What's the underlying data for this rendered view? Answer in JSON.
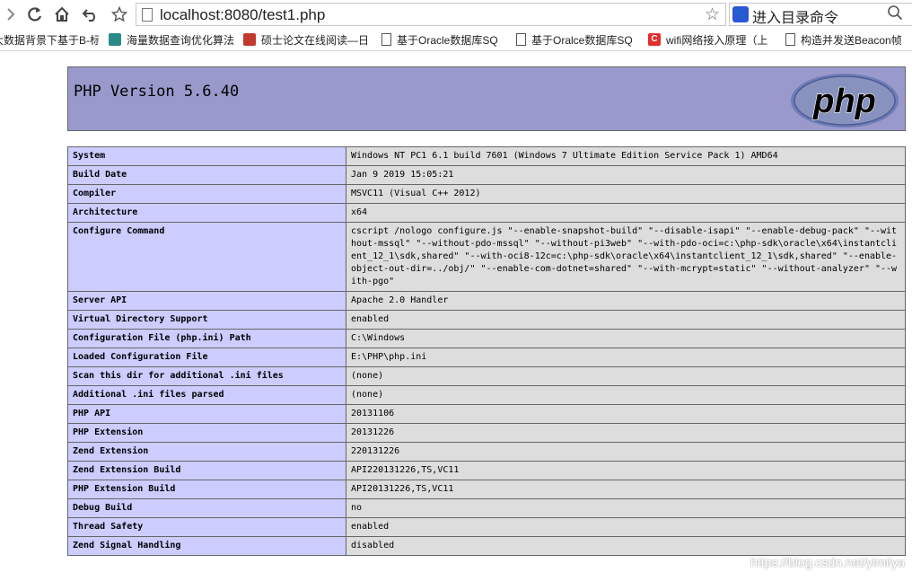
{
  "toolbar": {
    "url": "localhost:8080/test1.php",
    "search_text": "进入目录命令"
  },
  "bookmarks": [
    {
      "label": "大数据背景下基于B-标",
      "icon": "page"
    },
    {
      "label": "海量数据查询优化算法",
      "icon": "segmentfault"
    },
    {
      "label": "硕士论文在线阅读—日",
      "icon": "cnki"
    },
    {
      "label": "基于Oracle数据库SQ",
      "icon": "page"
    },
    {
      "label": "基于Oralce数据库SQ",
      "icon": "page"
    },
    {
      "label": "wifi网络接入原理（上",
      "icon": "csdn"
    },
    {
      "label": "构造并发送Beacon帧",
      "icon": "page"
    }
  ],
  "php": {
    "title": "PHP Version 5.6.40",
    "logo_text": "php",
    "rows": [
      {
        "key": "System",
        "value": "Windows NT PC1 6.1 build 7601 (Windows 7 Ultimate Edition Service Pack 1) AMD64"
      },
      {
        "key": "Build Date",
        "value": "Jan 9 2019 15:05:21"
      },
      {
        "key": "Compiler",
        "value": "MSVC11 (Visual C++ 2012)"
      },
      {
        "key": "Architecture",
        "value": "x64"
      },
      {
        "key": "Configure Command",
        "value": "cscript /nologo configure.js \"--enable-snapshot-build\" \"--disable-isapi\" \"--enable-debug-pack\" \"--without-mssql\" \"--without-pdo-mssql\" \"--without-pi3web\" \"--with-pdo-oci=c:\\php-sdk\\oracle\\x64\\instantclient_12_1\\sdk,shared\" \"--with-oci8-12c=c:\\php-sdk\\oracle\\x64\\instantclient_12_1\\sdk,shared\" \"--enable-object-out-dir=../obj/\" \"--enable-com-dotnet=shared\" \"--with-mcrypt=static\" \"--without-analyzer\" \"--with-pgo\""
      },
      {
        "key": "Server API",
        "value": "Apache 2.0 Handler"
      },
      {
        "key": "Virtual Directory Support",
        "value": "enabled"
      },
      {
        "key": "Configuration File (php.ini) Path",
        "value": "C:\\Windows"
      },
      {
        "key": "Loaded Configuration File",
        "value": "E:\\PHP\\php.ini"
      },
      {
        "key": "Scan this dir for additional .ini files",
        "value": "(none)"
      },
      {
        "key": "Additional .ini files parsed",
        "value": "(none)"
      },
      {
        "key": "PHP API",
        "value": "20131106"
      },
      {
        "key": "PHP Extension",
        "value": "20131226"
      },
      {
        "key": "Zend Extension",
        "value": "220131226"
      },
      {
        "key": "Zend Extension Build",
        "value": "API220131226,TS,VC11"
      },
      {
        "key": "PHP Extension Build",
        "value": "API20131226,TS,VC11"
      },
      {
        "key": "Debug Build",
        "value": "no"
      },
      {
        "key": "Thread Safety",
        "value": "enabled"
      },
      {
        "key": "Zend Signal Handling",
        "value": "disabled"
      }
    ]
  },
  "watermark": "https://blog.csdn.net/yimiiya"
}
